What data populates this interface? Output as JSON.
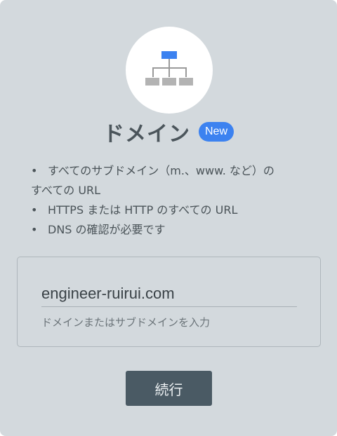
{
  "header": {
    "icon": "sitemap-icon",
    "title": "ドメイン",
    "badge": "New"
  },
  "bullets": [
    "すべてのサブドメイン（m.、www. など）の",
    "すべての URL",
    "HTTPS または HTTP のすべての URL",
    "DNS の確認が必要です"
  ],
  "form": {
    "domain_value": "engineer-ruirui.com",
    "helper_text": "ドメインまたはサブドメインを入力"
  },
  "actions": {
    "continue_label": "続行"
  },
  "colors": {
    "background": "#d3d9dd",
    "accent": "#3c82f0",
    "button": "#4a5a64"
  }
}
